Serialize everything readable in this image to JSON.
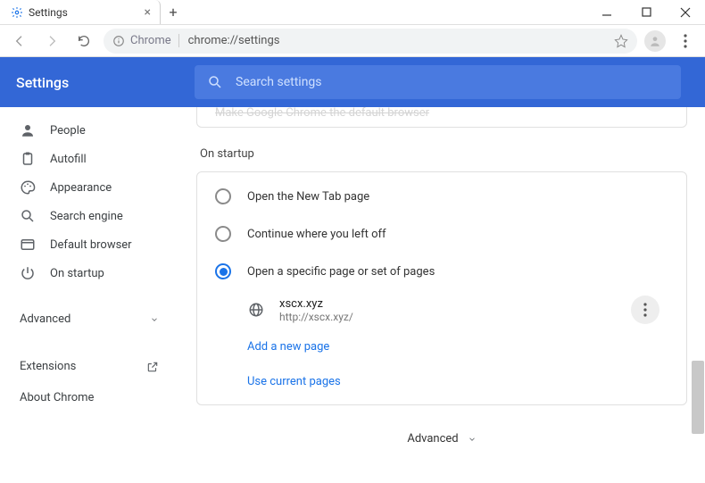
{
  "window": {
    "tab_title": "Settings",
    "new_tab_label": "+"
  },
  "omnibox": {
    "chip": "Chrome",
    "url": "chrome://settings"
  },
  "header": {
    "title": "Settings",
    "search_placeholder": "Search settings"
  },
  "sidebar": {
    "items": [
      {
        "label": "People"
      },
      {
        "label": "Autofill"
      },
      {
        "label": "Appearance"
      },
      {
        "label": "Search engine"
      },
      {
        "label": "Default browser"
      },
      {
        "label": "On startup"
      }
    ],
    "advanced": "Advanced",
    "extensions": "Extensions",
    "about": "About Chrome"
  },
  "stub": {
    "text": "Make Google Chrome the default browser"
  },
  "startup": {
    "section_title": "On startup",
    "opt_new_tab": "Open the New Tab page",
    "opt_continue": "Continue where you left off",
    "opt_specific": "Open a specific page or set of pages",
    "page": {
      "title": "xscx.xyz",
      "url": "http://xscx.xyz/"
    },
    "add_page": "Add a new page",
    "use_current": "Use current pages"
  },
  "footer": {
    "advanced": "Advanced"
  }
}
